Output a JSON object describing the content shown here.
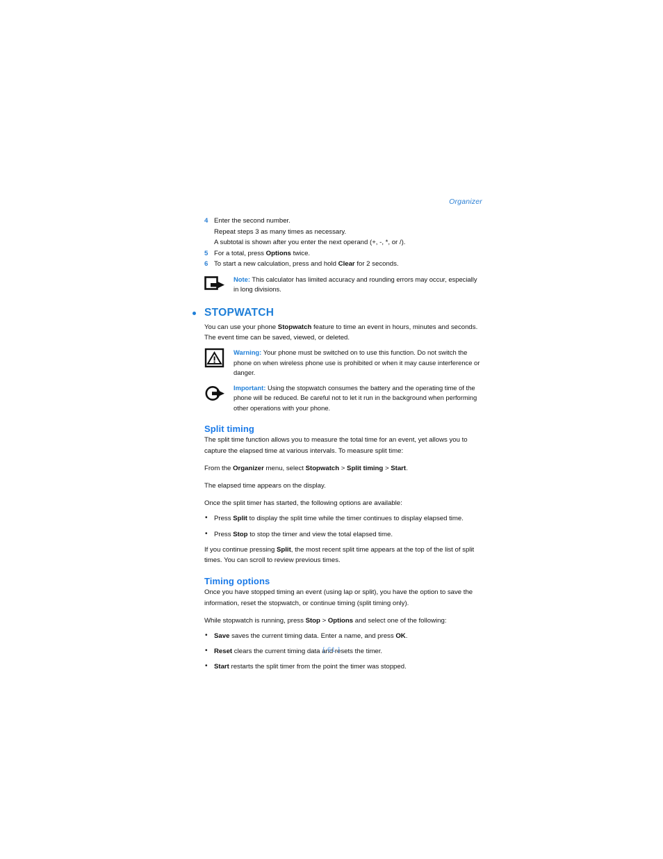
{
  "page": {
    "running_head": "Organizer",
    "folio": "[ 61 ]"
  },
  "steps": [
    {
      "num": "4",
      "text": "Enter the second number."
    },
    {
      "num": "5",
      "text_before": "For a total, press ",
      "bold": "Options",
      "text_after": " twice."
    },
    {
      "num": "6",
      "text_before": "To start a new calculation, press and hold ",
      "bold": "Clear",
      "text_after": " for 2 seconds."
    }
  ],
  "substeps": [
    "Repeat steps 3 as many times as necessary.",
    "A subtotal is shown after you enter the next operand (+, -, *, or /)."
  ],
  "note": {
    "icon": "note-arrow-square-icon",
    "label": "Note:",
    "text": " This calculator has limited accuracy and rounding errors may occur, especially in long divisions."
  },
  "stopwatch": {
    "heading": "STOPWATCH",
    "bullet_color": "#1f7fd8",
    "intro_before": "You can use your phone ",
    "intro_bold": "Stopwatch",
    "intro_after": " feature to time an event in hours, minutes and seconds. The event time can be saved, viewed, or deleted.",
    "warning": {
      "icon": "warning-triangle-icon",
      "label": "Warning:",
      "text": " Your phone must be switched on to use this function. Do not switch the phone on when wireless phone use is prohibited or when it may cause interference or danger."
    },
    "important": {
      "icon": "important-circle-arrow-icon",
      "label": "Important:",
      "text": " Using the stopwatch consumes the battery and the operating time of the phone will be reduced. Be careful not to let it run in the background when performing other operations with your phone."
    }
  },
  "split_timing": {
    "heading": "Split timing",
    "intro": "The split time function allows you to measure the total time for an event, yet allows you to capture the elapsed time at various intervals. To measure split time:",
    "path_p1": "From the ",
    "path_b1": "Organizer",
    "path_p2": " menu, select ",
    "path_b2": "Stopwatch",
    "path_sep1": " > ",
    "path_b3": "Split timing",
    "path_sep2": " > ",
    "path_b4": "Start",
    "path_end": ".",
    "elapsed": "The elapsed time appears on the display.",
    "options_intro": "Once the split timer has started, the following options are available:",
    "options": [
      {
        "pre": "Press ",
        "bold": "Split",
        "post": " to display the split time while the timer continues to display elapsed time."
      },
      {
        "pre": "Press ",
        "bold": "Stop",
        "post": " to stop the timer and view the total elapsed time."
      }
    ],
    "continue_pre": "If you continue pressing ",
    "continue_bold": "Split",
    "continue_post": ", the most recent split time appears at the top of the list of split times. You can scroll to review previous times."
  },
  "timing_options": {
    "heading": "Timing options",
    "intro": "Once you have stopped timing an event (using lap or split), you have the option to save the information, reset the stopwatch, or continue timing (split timing only).",
    "while_pre": "While stopwatch is running, press ",
    "while_b1": "Stop",
    "while_sep": " > ",
    "while_b2": "Options",
    "while_post": " and select one of the following:",
    "items": [
      {
        "bold": "Save",
        "pre": "",
        "post": " saves the current timing data. Enter a name, and press ",
        "bold2": "OK",
        "tail": "."
      },
      {
        "bold": "Reset",
        "pre": "",
        "post": " clears the current timing data and resets the timer.",
        "bold2": "",
        "tail": ""
      },
      {
        "bold": "Start",
        "pre": "",
        "post": " restarts the split timer from the point the timer was stopped.",
        "bold2": "",
        "tail": ""
      }
    ]
  }
}
